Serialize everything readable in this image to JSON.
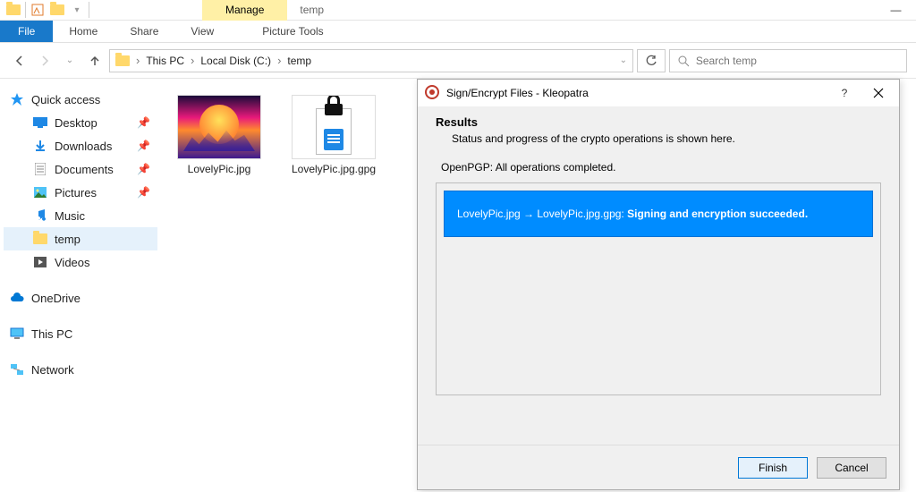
{
  "window": {
    "context_tab": "Manage",
    "context_title": "temp"
  },
  "ribbon": {
    "file": "File",
    "home": "Home",
    "share": "Share",
    "view": "View",
    "tools": "Picture Tools"
  },
  "address": {
    "segments": [
      "This PC",
      "Local Disk (C:)",
      "temp"
    ],
    "search_placeholder": "Search temp"
  },
  "nav": {
    "quick_access": "Quick access",
    "desktop": "Desktop",
    "downloads": "Downloads",
    "documents": "Documents",
    "pictures": "Pictures",
    "music": "Music",
    "temp": "temp",
    "videos": "Videos",
    "onedrive": "OneDrive",
    "this_pc": "This PC",
    "network": "Network"
  },
  "files": {
    "f1": "LovelyPic.jpg",
    "f2": "LovelyPic.jpg.gpg"
  },
  "dialog": {
    "title": "Sign/Encrypt Files - Kleopatra",
    "heading": "Results",
    "desc": "Status and progress of the crypto operations is shown here.",
    "status_line": "OpenPGP: All operations completed.",
    "msg_prefix": "LovelyPic.jpg → LovelyPic.jpg.gpg: ",
    "msg_bold": "Signing and encryption succeeded.",
    "finish": "Finish",
    "cancel": "Cancel"
  }
}
